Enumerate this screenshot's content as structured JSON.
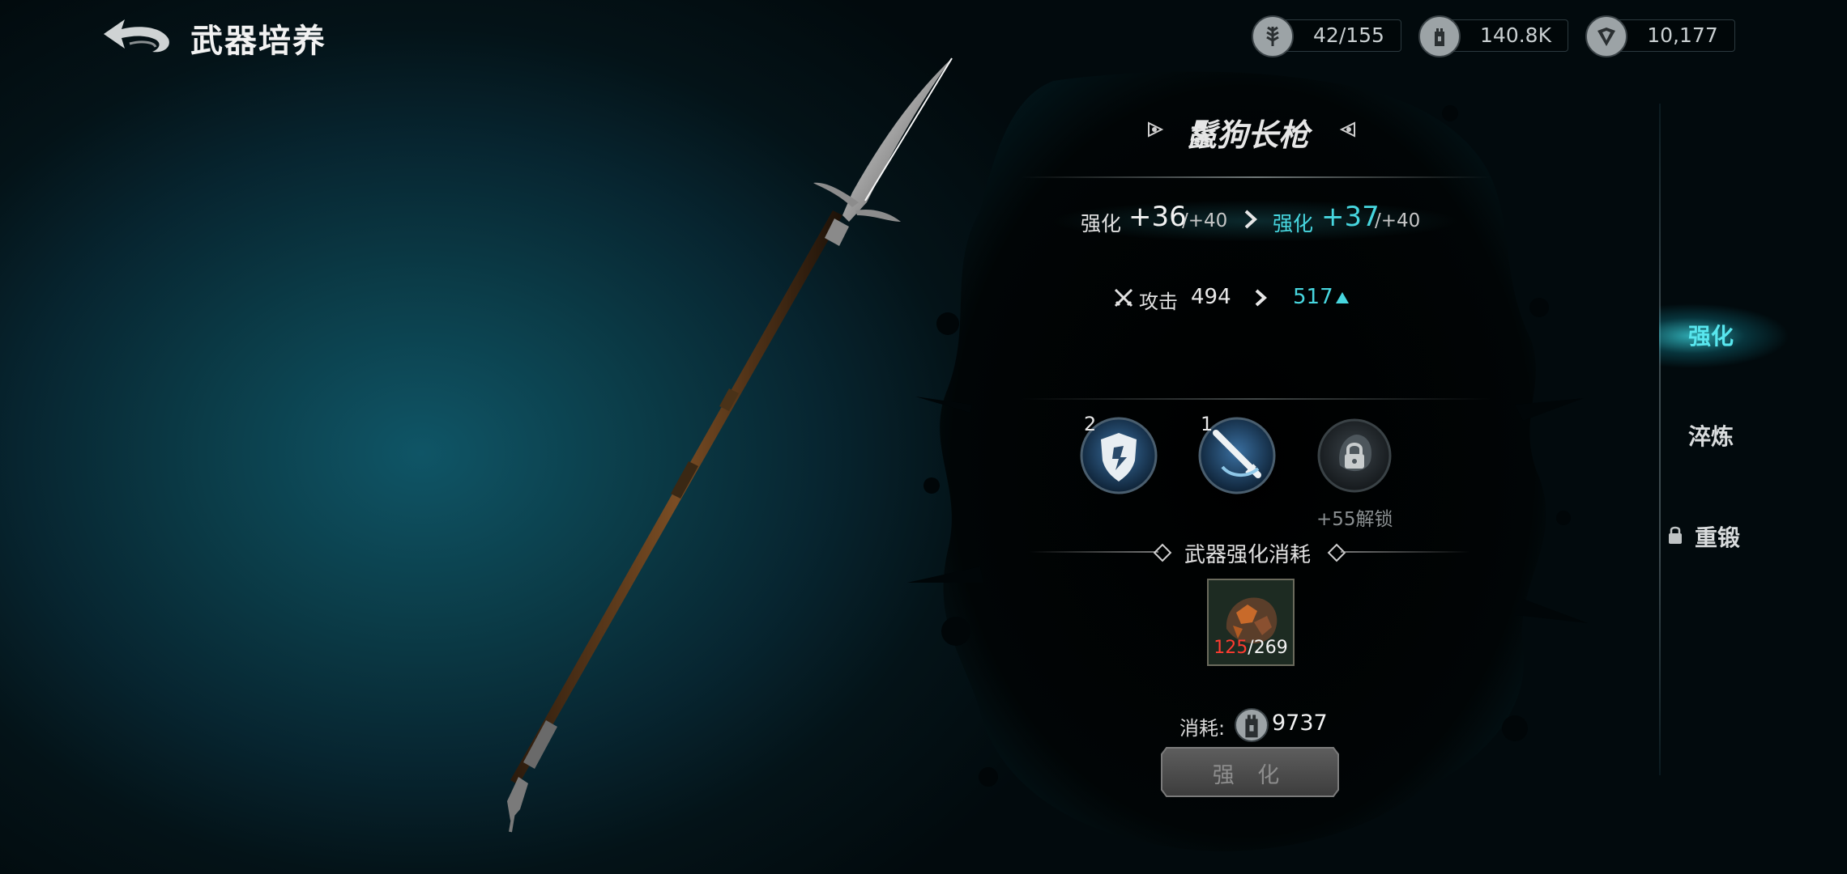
{
  "header": {
    "title": "武器培养",
    "resources": [
      {
        "icon": "wheat-emblem-icon",
        "value": "42/155"
      },
      {
        "icon": "tower-coin-icon",
        "value": "140.8K"
      },
      {
        "icon": "shield-gem-icon",
        "value": "10,177"
      }
    ]
  },
  "weapon": {
    "name": "鬣狗长枪"
  },
  "enhance": {
    "label_current": "强化",
    "current_value": "+36",
    "current_max": "/+40",
    "label_next": "强化",
    "next_value": "+37",
    "next_max": "/+40"
  },
  "attack": {
    "icon": "crossed-swords-icon",
    "label": "攻击",
    "current": "494",
    "next": "517"
  },
  "skills": [
    {
      "icon": "shield-emblem-icon",
      "level": "2"
    },
    {
      "icon": "sword-slash-icon",
      "level": "1"
    },
    {
      "icon": "locked-wolf-icon",
      "unlock_text": "+55解锁"
    }
  ],
  "cost": {
    "title": "武器强化消耗",
    "material": {
      "icon": "ore-material-icon",
      "have": "125",
      "need": "/269"
    },
    "consume_label": "消耗:",
    "consume_value": "9737"
  },
  "action_button": "强 化",
  "tabs": [
    {
      "label": "强化",
      "active": true
    },
    {
      "label": "淬炼",
      "active": false
    },
    {
      "label": "重锻",
      "active": false,
      "locked": true
    }
  ],
  "colors": {
    "accent": "#47d6df",
    "insufficient": "#ff3b30"
  }
}
